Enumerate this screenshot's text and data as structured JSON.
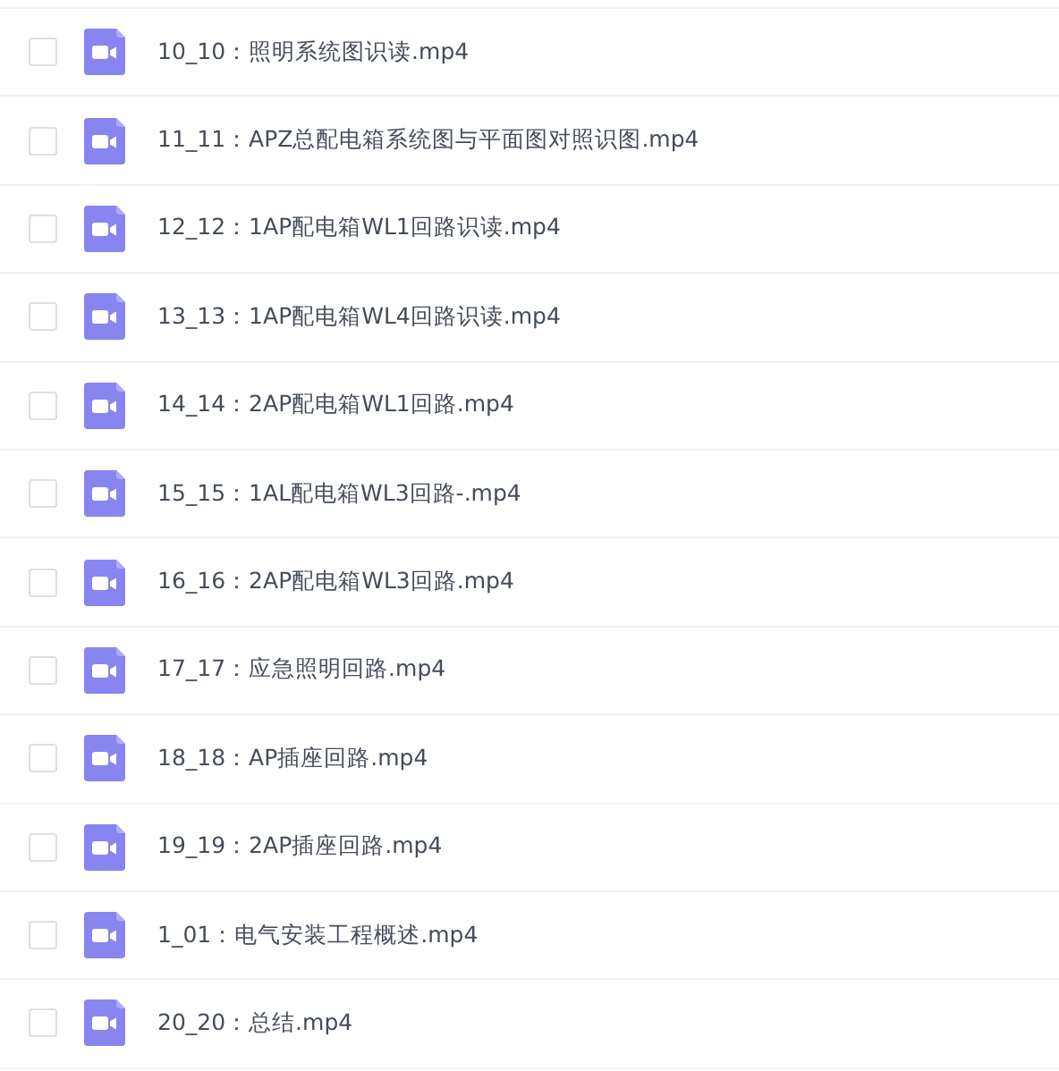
{
  "files": [
    {
      "name": "10_10：照明系统图识读.mp4",
      "checked": false
    },
    {
      "name": "11_11：APZ总配电箱系统图与平面图对照识图.mp4",
      "checked": false
    },
    {
      "name": "12_12：1AP配电箱WL1回路识读.mp4",
      "checked": false
    },
    {
      "name": "13_13：1AP配电箱WL4回路识读.mp4",
      "checked": false
    },
    {
      "name": "14_14：2AP配电箱WL1回路.mp4",
      "checked": false
    },
    {
      "name": "15_15：1AL配电箱WL3回路-.mp4",
      "checked": false
    },
    {
      "name": "16_16：2AP配电箱WL3回路.mp4",
      "checked": false
    },
    {
      "name": "17_17：应急照明回路.mp4",
      "checked": false
    },
    {
      "name": "18_18：AP插座回路.mp4",
      "checked": false
    },
    {
      "name": "19_19：2AP插座回路.mp4",
      "checked": false
    },
    {
      "name": "1_01：电气安装工程概述.mp4",
      "checked": false
    },
    {
      "name": "20_20：总结.mp4",
      "checked": false
    }
  ]
}
